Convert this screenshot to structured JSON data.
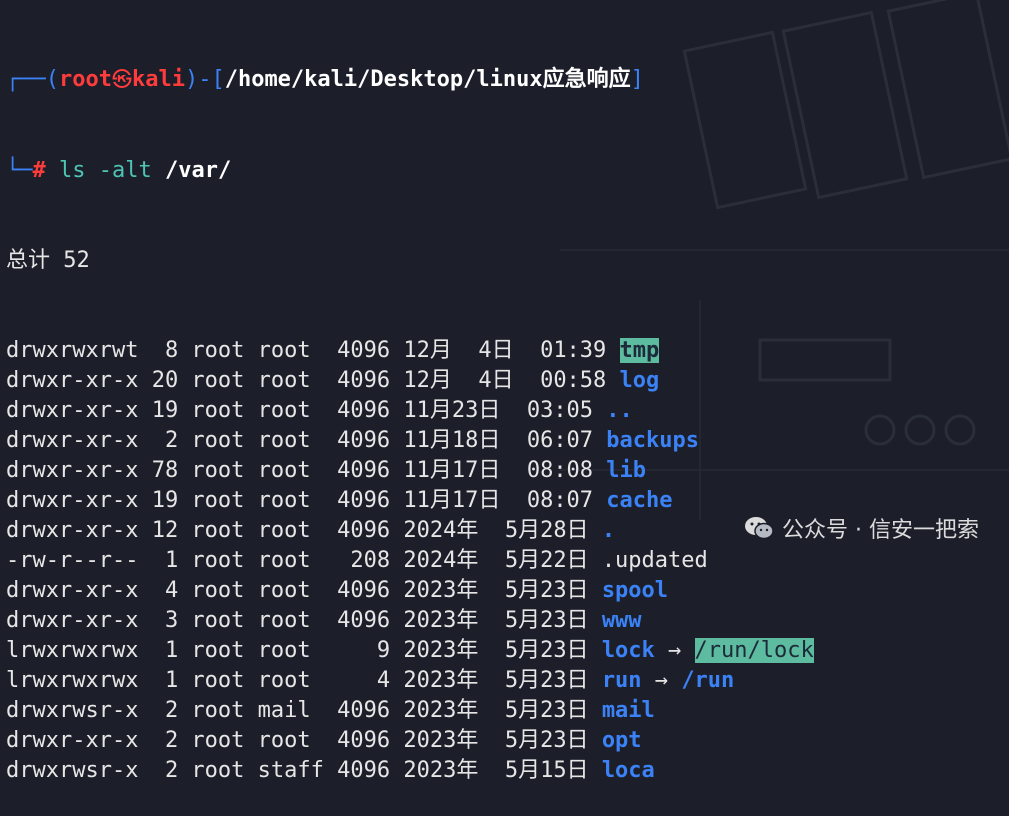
{
  "prompt": {
    "frame_top_left": "┌──(",
    "user": "root",
    "host_sep": "㉿",
    "host": "kali",
    "frame_mid": ")-[",
    "path": "/home/kali/Desktop/linux应急响应",
    "frame_end": "]",
    "frame_bottom": "└─",
    "hash": "#",
    "command_bin": "ls",
    "command_flags": "-alt",
    "command_path": "/var/"
  },
  "total_line": "总计 52",
  "rows": [
    {
      "meta": "drwxrwxrwt  8 root root  4096 12月  4日  01:39 ",
      "name": "tmp",
      "style": "hl"
    },
    {
      "meta": "drwxr-xr-x 20 root root  4096 12月  4日  00:58 ",
      "name": "log",
      "style": "dir"
    },
    {
      "meta": "drwxr-xr-x 19 root root  4096 11月23日  03:05 ",
      "name": "..",
      "style": "dir"
    },
    {
      "meta": "drwxr-xr-x  2 root root  4096 11月18日  06:07 ",
      "name": "backups",
      "style": "dir"
    },
    {
      "meta": "drwxr-xr-x 78 root root  4096 11月17日  08:08 ",
      "name": "lib",
      "style": "dir"
    },
    {
      "meta": "drwxr-xr-x 19 root root  4096 11月17日  08:07 ",
      "name": "cache",
      "style": "dir"
    },
    {
      "meta": "drwxr-xr-x 12 root root  4096 2024年  5月28日 ",
      "name": ".",
      "style": "dir"
    },
    {
      "meta": "-rw-r--r--  1 root root   208 2024年  5月22日 ",
      "name": ".updated",
      "style": "file"
    },
    {
      "meta": "drwxr-xr-x  4 root root  4096 2023年  5月23日 ",
      "name": "spool",
      "style": "dir"
    },
    {
      "meta": "drwxr-xr-x  3 root root  4096 2023年  5月23日 ",
      "name": "www",
      "style": "dir"
    },
    {
      "meta": "lrwxrwxrwx  1 root root     9 2023年  5月23日 ",
      "name": "lock",
      "style": "dir",
      "arrow": " → ",
      "target": "/run/lock",
      "target_style": "hl"
    },
    {
      "meta": "lrwxrwxrwx  1 root root     4 2023年  5月23日 ",
      "name": "run",
      "style": "dir",
      "arrow": " → ",
      "target": "/run",
      "target_style": "dir"
    },
    {
      "meta": "drwxrwsr-x  2 root mail  4096 2023年  5月23日 ",
      "name": "mail",
      "style": "dir"
    },
    {
      "meta": "drwxr-xr-x  2 root root  4096 2023年  5月23日 ",
      "name": "opt",
      "style": "dir"
    },
    {
      "meta": "drwxrwsr-x  2 root staff 4096 2023年  5月15日 ",
      "name": "loca",
      "style": "dir"
    }
  ],
  "watermark": {
    "text": "公众号 · 信安一把索",
    "icon": "wechat-icon"
  },
  "colors": {
    "background": "#1c1f2a",
    "directory": "#3b82f6",
    "highlight_bg": "#5dbb9f",
    "prompt_red": "#ff3b3b"
  }
}
